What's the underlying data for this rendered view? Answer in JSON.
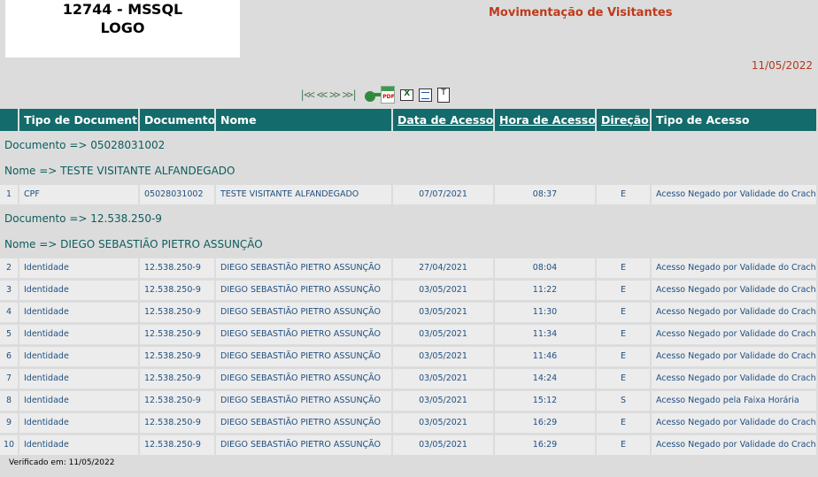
{
  "logo": {
    "line1": "12744 - MSSQL",
    "line2": "LOGO"
  },
  "title": "Movimentação de Visitantes",
  "date": "11/05/2022",
  "toolbar": {
    "nav": [
      "|<<",
      "<<",
      ">>",
      ">>|"
    ],
    "icons": [
      "search-icon",
      "pdf-icon",
      "excel-icon",
      "word-icon",
      "text-icon"
    ]
  },
  "columns": [
    "Tipo de Documento",
    "Documento",
    "Nome",
    "Data de Acesso",
    "Hora de Acesso",
    "Direção",
    "Tipo de Acesso"
  ],
  "groups": [
    {
      "documento": "Documento => 05028031002",
      "nome": "Nome => TESTE VISITANTE ALFANDEGADO"
    },
    {
      "documento": "Documento => 12.538.250-9",
      "nome": "Nome => DIEGO SEBASTIÃO PIETRO ASSUNÇÃO"
    }
  ],
  "rows": [
    [
      "1",
      "CPF",
      "05028031002",
      "TESTE VISITANTE ALFANDEGADO",
      "07/07/2021",
      "08:37",
      "E",
      "Acesso Negado por Validade do Crach"
    ],
    [
      "2",
      "Identidade",
      "12.538.250-9",
      "DIEGO SEBASTIÃO PIETRO ASSUNÇÃO",
      "27/04/2021",
      "08:04",
      "E",
      "Acesso Negado por Validade do Crach"
    ],
    [
      "3",
      "Identidade",
      "12.538.250-9",
      "DIEGO SEBASTIÃO PIETRO ASSUNÇÃO",
      "03/05/2021",
      "11:22",
      "E",
      "Acesso Negado por Validade do Crach"
    ],
    [
      "4",
      "Identidade",
      "12.538.250-9",
      "DIEGO SEBASTIÃO PIETRO ASSUNÇÃO",
      "03/05/2021",
      "11:30",
      "E",
      "Acesso Negado por Validade do Crach"
    ],
    [
      "5",
      "Identidade",
      "12.538.250-9",
      "DIEGO SEBASTIÃO PIETRO ASSUNÇÃO",
      "03/05/2021",
      "11:34",
      "E",
      "Acesso Negado por Validade do Crach"
    ],
    [
      "6",
      "Identidade",
      "12.538.250-9",
      "DIEGO SEBASTIÃO PIETRO ASSUNÇÃO",
      "03/05/2021",
      "11:46",
      "E",
      "Acesso Negado por Validade do Crach"
    ],
    [
      "7",
      "Identidade",
      "12.538.250-9",
      "DIEGO SEBASTIÃO PIETRO ASSUNÇÃO",
      "03/05/2021",
      "14:24",
      "E",
      "Acesso Negado por Validade do Crach"
    ],
    [
      "8",
      "Identidade",
      "12.538.250-9",
      "DIEGO SEBASTIÃO PIETRO ASSUNÇÃO",
      "03/05/2021",
      "15:12",
      "S",
      "Acesso Negado pela Faixa Horária"
    ],
    [
      "9",
      "Identidade",
      "12.538.250-9",
      "DIEGO SEBASTIÃO PIETRO ASSUNÇÃO",
      "03/05/2021",
      "16:29",
      "E",
      "Acesso Negado por Validade do Crach"
    ],
    [
      "10",
      "Identidade",
      "12.538.250-9",
      "DIEGO SEBASTIÃO PIETRO ASSUNÇÃO",
      "03/05/2021",
      "16:29",
      "E",
      "Acesso Negado por Validade do Crach"
    ]
  ],
  "footer": "Verificado em: 11/05/2022"
}
